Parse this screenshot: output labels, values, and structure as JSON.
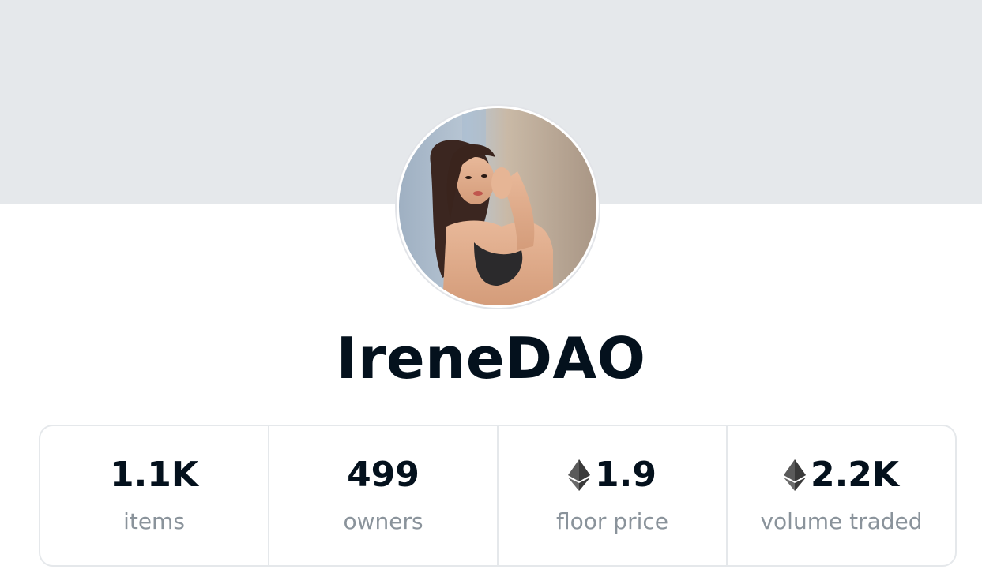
{
  "collection": {
    "name": "IreneDAO",
    "avatar_alt": "IreneDAO collection avatar"
  },
  "stats": [
    {
      "value": "1.1K",
      "label": "items",
      "eth": false
    },
    {
      "value": "499",
      "label": "owners",
      "eth": false
    },
    {
      "value": "1.9",
      "label": "floor price",
      "eth": true,
      "icon": "ethereum-icon"
    },
    {
      "value": "2.2K",
      "label": "volume traded",
      "eth": true,
      "icon": "ethereum-icon"
    }
  ],
  "colors": {
    "banner": "#e5e8eb",
    "text": "#04111d",
    "label": "#8a939b",
    "border": "#e5e8eb"
  }
}
